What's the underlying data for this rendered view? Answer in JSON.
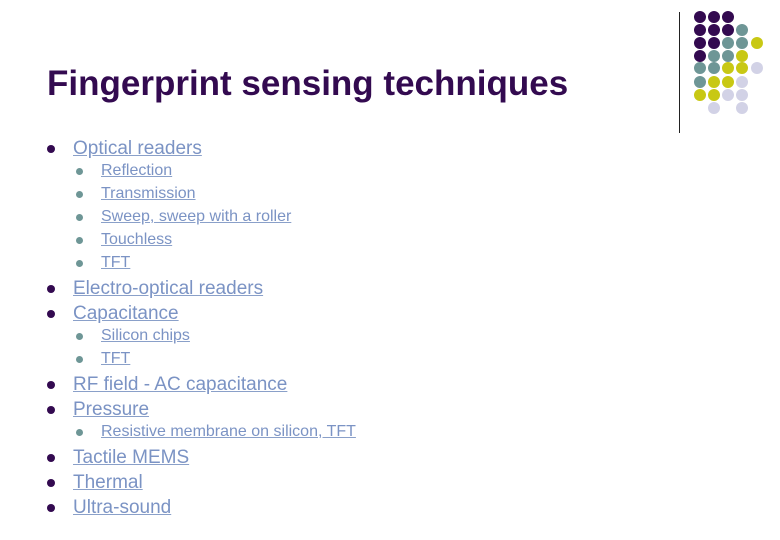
{
  "slide": {
    "title": "Fingerprint sensing techniques",
    "colors": {
      "title": "#330a50",
      "link": "#7b93c4",
      "bullet_level1": "#330a50",
      "bullet_level2": "#6e9696",
      "dot_purple": "#330a50",
      "dot_teal": "#6e9696",
      "dot_yellow": "#c8c814",
      "dot_lavender": "#d2d2e6"
    },
    "items": [
      {
        "label": "Optical readers",
        "level": 1
      },
      {
        "label": "Reflection",
        "level": 2
      },
      {
        "label": "Transmission",
        "level": 2
      },
      {
        "label": "Sweep, sweep with a roller",
        "level": 2
      },
      {
        "label": "Touchless",
        "level": 2
      },
      {
        "label": "TFT",
        "level": 2
      },
      {
        "label": "Electro-optical readers",
        "level": 1
      },
      {
        "label": "Capacitance",
        "level": 1
      },
      {
        "label": "Silicon chips",
        "level": 2
      },
      {
        "label": "TFT",
        "level": 2
      },
      {
        "label": "RF field - AC capacitance",
        "level": 1
      },
      {
        "label": "Pressure",
        "level": 1
      },
      {
        "label": "Resistive membrane on silicon, TFT",
        "level": 2
      },
      {
        "label": "Tactile MEMS",
        "level": 1
      },
      {
        "label": "Thermal",
        "level": 1
      },
      {
        "label": "Ultra-sound",
        "level": 1
      }
    ],
    "dot_grid": [
      [
        "purple",
        "purple",
        "purple",
        "",
        ""
      ],
      [
        "purple",
        "purple",
        "purple",
        "teal",
        ""
      ],
      [
        "purple",
        "purple",
        "teal",
        "teal",
        "yellow"
      ],
      [
        "purple",
        "teal",
        "teal",
        "yellow",
        ""
      ],
      [
        "teal",
        "teal",
        "yellow",
        "yellow",
        "lavender"
      ],
      [
        "teal",
        "yellow",
        "yellow",
        "lavender",
        ""
      ],
      [
        "yellow",
        "yellow",
        "lavender",
        "lavender",
        ""
      ],
      [
        "",
        "lavender",
        "",
        "lavender",
        ""
      ]
    ]
  }
}
